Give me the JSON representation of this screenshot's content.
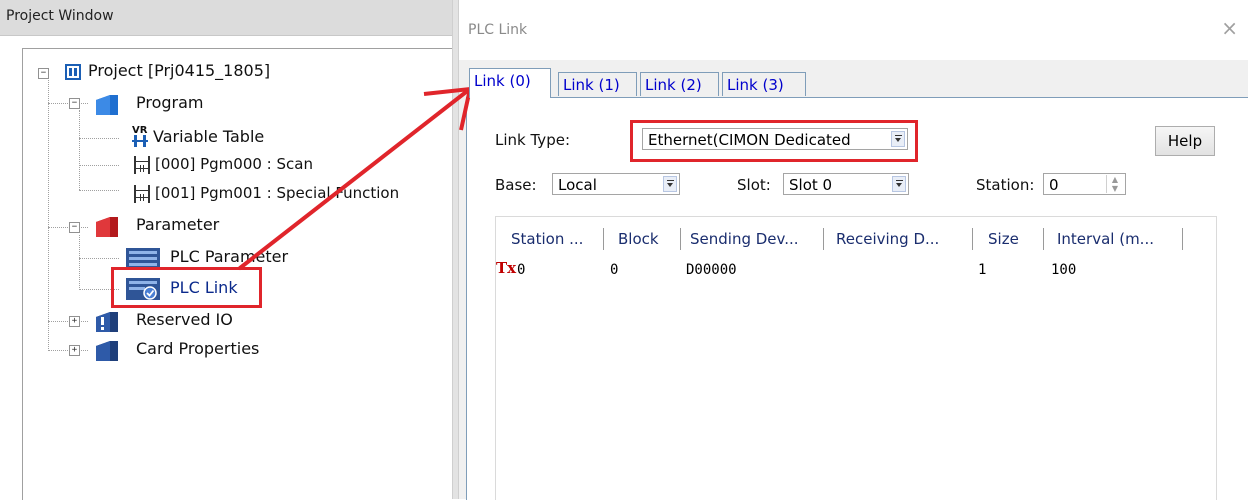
{
  "project_window": {
    "title": "Project Window",
    "tree": {
      "project": "Project [Prj0415_1805]",
      "program": "Program",
      "variable_table": "Variable Table",
      "pgm000": "[000] Pgm000 : Scan",
      "pgm001": "[001] Pgm001 : Special Function",
      "parameter": "Parameter",
      "plc_parameter": "PLC Parameter",
      "plc_link": "PLC Link",
      "reserved_io": "Reserved IO",
      "card_properties": "Card Properties",
      "vr_badge": "VR"
    }
  },
  "dialog": {
    "title": "PLC Link",
    "close": "×",
    "tabs": [
      "Link (0)",
      "Link (1)",
      "Link (2)",
      "Link (3)"
    ],
    "active_tab": 0,
    "link_type_label": "Link Type:",
    "link_type_value": "Ethernet(CIMON Dedicated",
    "help_label": "Help",
    "base_label": "Base:",
    "base_value": "Local",
    "slot_label": "Slot:",
    "slot_value": "Slot 0",
    "station_label": "Station:",
    "station_value": "0",
    "table": {
      "columns": [
        "Station ...",
        "Block",
        "Sending Dev...",
        "Receiving D...",
        "Size",
        "Interval (m..."
      ],
      "rows": [
        {
          "mode": "Tx",
          "station": "0",
          "block": "0",
          "sending": "D00000",
          "receiving": "",
          "size": "1",
          "interval": "100"
        }
      ]
    }
  },
  "colors": {
    "highlight_red": "#e0252b",
    "link_blue": "#0000cc"
  }
}
